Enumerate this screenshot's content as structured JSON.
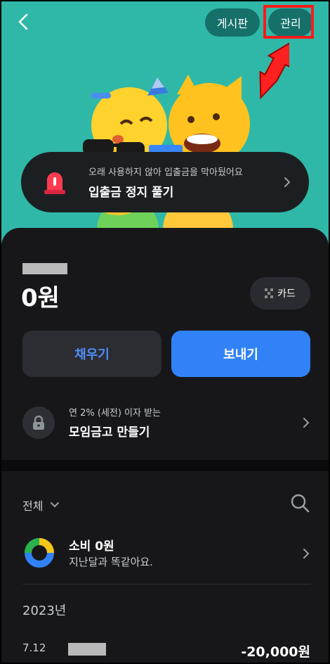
{
  "header": {
    "board_label": "게시판",
    "manage_label": "관리"
  },
  "notice": {
    "subtitle": "오래 사용하지 않아 입출금을 막아뒀어요",
    "title": "입출금 정지 풀기"
  },
  "account": {
    "balance": "0원",
    "card_label": "카드",
    "fill_label": "채우기",
    "send_label": "보내기"
  },
  "savings": {
    "subtitle": "연 2% (세전) 이자 받는",
    "title": "모임금고 만들기"
  },
  "transactions": {
    "filter_label": "전체",
    "spend_title": "소비 0원",
    "spend_subtitle": "지난달과 똑같아요.",
    "year_label": "2023년",
    "rows": [
      {
        "date": "7.12",
        "amount": "-20,000원"
      }
    ]
  },
  "colors": {
    "hero_bg": "#2fb8a8",
    "primary_blue": "#3182f6",
    "panel_bg": "#17171a",
    "highlight_red": "#ff1a1a"
  }
}
